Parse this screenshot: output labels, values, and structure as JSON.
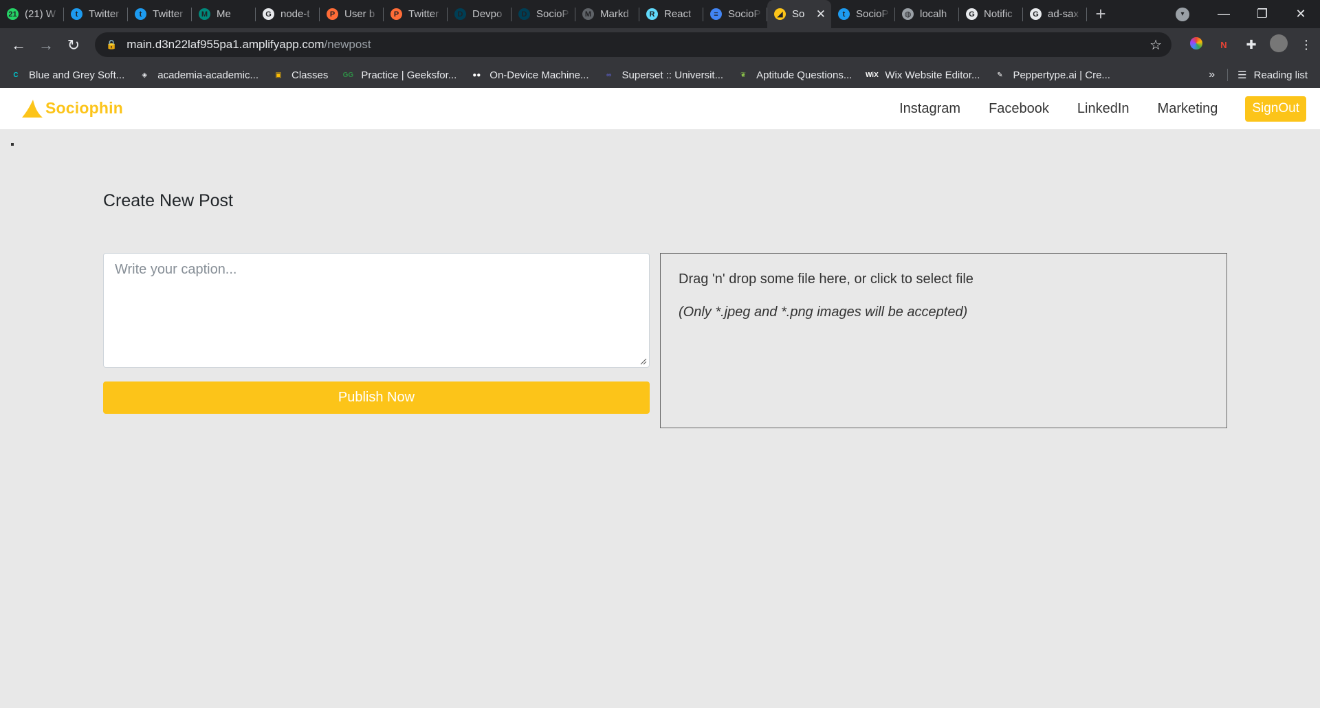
{
  "browser": {
    "tabs": [
      {
        "label": "(21) W",
        "icon": "whatsapp-icon",
        "color": "#25d366",
        "glyph": "21"
      },
      {
        "label": "Twitter",
        "icon": "twitter-icon",
        "color": "#1d9bf0",
        "glyph": "t"
      },
      {
        "label": "Twitter",
        "icon": "twitter-icon",
        "color": "#1d9bf0",
        "glyph": "t"
      },
      {
        "label": "Me",
        "icon": "meet-icon",
        "color": "#00897b",
        "glyph": "M"
      },
      {
        "label": "node-t",
        "icon": "github-icon",
        "color": "#e8eaed",
        "glyph": "G"
      },
      {
        "label": "User b",
        "icon": "postman-icon",
        "color": "#ff6c37",
        "glyph": "P"
      },
      {
        "label": "Twitter",
        "icon": "postman-icon",
        "color": "#ff6c37",
        "glyph": "P"
      },
      {
        "label": "Devpo",
        "icon": "devpost-icon",
        "color": "#003e54",
        "glyph": "D"
      },
      {
        "label": "SocioP",
        "icon": "devpost-icon",
        "color": "#003e54",
        "glyph": "D"
      },
      {
        "label": "Markd",
        "icon": "markdown-icon",
        "color": "#5f6368",
        "glyph": "M"
      },
      {
        "label": "React",
        "icon": "react-icon",
        "color": "#61dafb",
        "glyph": "R"
      },
      {
        "label": "SocioP",
        "icon": "docs-icon",
        "color": "#4285f4",
        "glyph": "≡"
      },
      {
        "label": "So",
        "icon": "sociophin-icon",
        "color": "#fcc419",
        "glyph": "◢"
      },
      {
        "label": "SocioP",
        "icon": "twitter-icon",
        "color": "#1d9bf0",
        "glyph": "t"
      },
      {
        "label": "localh",
        "icon": "globe-icon",
        "color": "#9aa0a6",
        "glyph": "◍"
      },
      {
        "label": "Notific",
        "icon": "github-icon",
        "color": "#e8eaed",
        "glyph": "G"
      },
      {
        "label": "ad-sax",
        "icon": "github-icon",
        "color": "#e8eaed",
        "glyph": "G"
      }
    ],
    "active_tab_index": 12,
    "url_host": "main.d3n22laf955pa1.amplifyapp.com",
    "url_path": "/newpost",
    "bookmarks": [
      {
        "label": "Blue and Grey Soft...",
        "icon": "canva-icon",
        "color": "#00c4cc",
        "glyph": "C"
      },
      {
        "label": "academia-academic...",
        "icon": "diamond-icon",
        "color": "#e8eaed",
        "glyph": "◈"
      },
      {
        "label": "Classes",
        "icon": "classroom-icon",
        "color": "#fbbc05",
        "glyph": "▣"
      },
      {
        "label": "Practice | Geeksfor...",
        "icon": "gfg-icon",
        "color": "#2f8d46",
        "glyph": "GG"
      },
      {
        "label": "On-Device Machine...",
        "icon": "medium-icon",
        "color": "#ffffff",
        "glyph": "●●"
      },
      {
        "label": "Superset :: Universit...",
        "icon": "superset-icon",
        "color": "#5b5fc7",
        "glyph": "∞"
      },
      {
        "label": "Aptitude Questions...",
        "icon": "leaf-icon",
        "color": "#8bc34a",
        "glyph": "❦"
      },
      {
        "label": "Wix Website Editor...",
        "icon": "wix-icon",
        "color": "#ffffff",
        "glyph": "WiX"
      },
      {
        "label": "Peppertype.ai | Cre...",
        "icon": "peppertype-icon",
        "color": "#ffffff",
        "glyph": "✎"
      }
    ],
    "more_bookmarks": "»",
    "reading_list": "Reading list"
  },
  "app": {
    "brand": "Sociophin",
    "brand_color": "#fcc419",
    "nav_links": [
      "Instagram",
      "Facebook",
      "LinkedIn",
      "Marketing"
    ],
    "signout_label": "SignOut"
  },
  "page": {
    "title": "Create New Post",
    "caption_placeholder": "Write your caption...",
    "publish_label": "Publish Now",
    "dropzone_text": "Drag 'n' drop some file here, or click to select file",
    "dropzone_hint": "(Only *.jpeg and *.png images will be accepted)"
  }
}
